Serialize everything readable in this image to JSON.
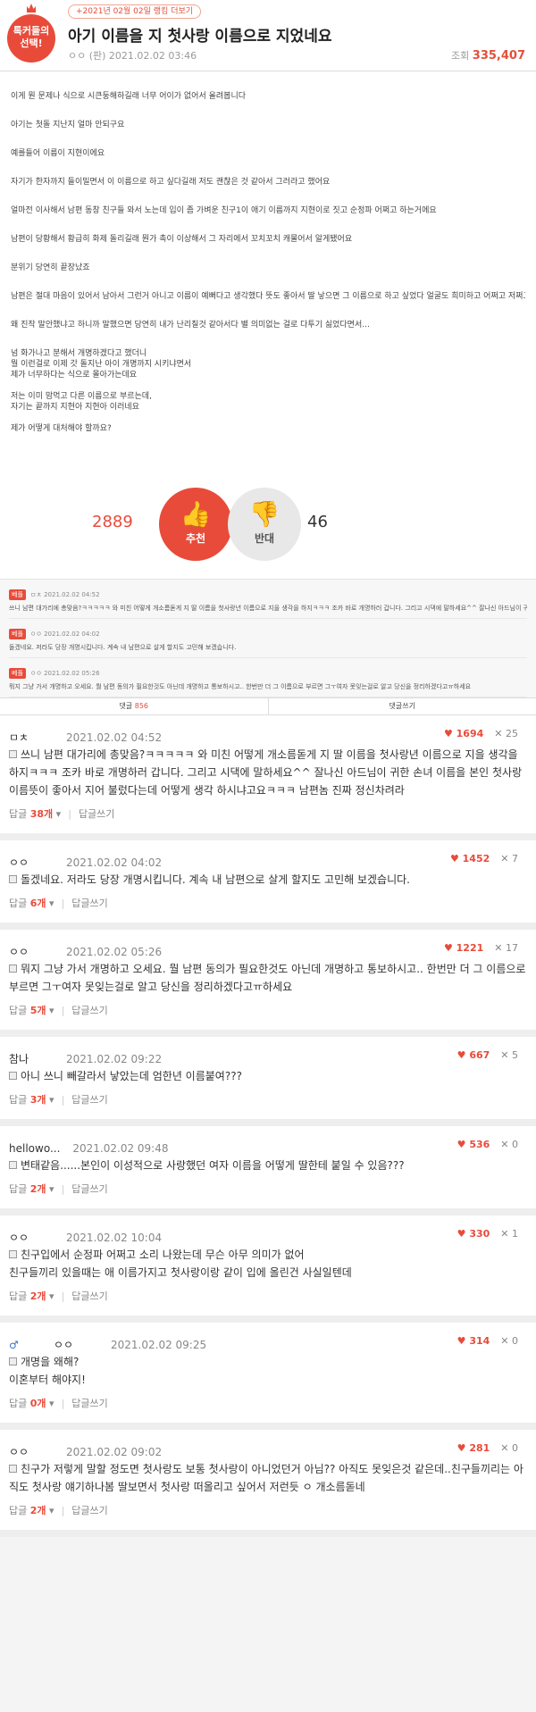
{
  "post": {
    "badge": "톡커들의\n선택!",
    "rank_pill": "+2021년 02월 02일 랭킹 더보기",
    "title": "아기 이름을 지 첫사랑 이름으로 지었네요",
    "author_date": "ㅇㅇ (판)  2021.02.02 03:46",
    "views_label": "조회",
    "views": "335,407",
    "paragraphs": [
      "이게 뭔 문제나 식으로 시큰둥해하길래 너무 어이가 없어서 올려봅니다",
      "아기는 첫돌 지난지 얼마 안되구요",
      "예를들어 이름이 지현이에요",
      "자기가 한자까지 들이밀면서 이 이름으로 하고 싶다길래 저도 괜찮은 것 같아서 그러라고 했어요",
      "얼마전 이사해서 남편 동창 친구들 와서 노는데 입이 좀 가벼운 친구1이 애기 이름까지 지현이로 짓고 순정파 어쩌고 하는거에요",
      "남편이 당황해서 황급히 화제 돌리길래 뭔가 촉이 이상해서 그 자리에서 꼬치꼬치 캐물어서 알게됐어요",
      "분위기 당연히 끝장났죠",
      "남편은 절대 마음이 있어서 남아서 그런거 아니고 이름이 예뻐다고 생각했다 뜻도 좋아서 딸 낳으면 그 이름으로 하고 싶었다 얼굴도 희미하고 어쩌고 저쩌고",
      "왜 진작 말안했냐고 하니까 말했으면 당연히 내가 난리칠것 같아서다 별 의미없는 걸로 다투기 싫었다면서...",
      "넘 화가나고 분해서 개명하겠다고 했더니\n뭘 이런걸로 이제 갓 돌지난 아이 개명까지 시키냐면서\n제가 너무하다는 식으로 몰아가는데요",
      "저는 이미 맘먹고 다른 이름으로 부르는데,\n자기는 끝까지 지현아 지현아 이러네요",
      "제가 어떻게 대처해야 할까요?"
    ],
    "up_count": "2889",
    "up_label": "추천",
    "down_label": "반대",
    "down_count": "46"
  },
  "best": [
    {
      "tag": "베플",
      "meta": "ㅁㅊ  2021.02.02 04:52",
      "text": "쓰니 남편 대가리에 총맞음?ㅋㅋㅋㅋㅋ 와 미친 어떻게 개소름돋게 지 딸 이름을 첫사랑년 이름으로 지을 생각을 하지ㅋㅋㅋ 조카 바로 개명하러 갑니다. 그리고 시댁에 말하세요^^ 잘나신 아드님이 귀한 손녀 이름을 본인 첫사랑 이름뜻이 좋아서 지어 불렀다는데 어떻게 생각 하시냐고요ㅋㅋㅋ 남편놈 진짜 정신차려라"
    },
    {
      "tag": "베플",
      "meta": "ㅇㅇ  2021.02.02 04:02",
      "text": "돌겠네요. 저라도 당장 개명시킵니다. 계속 내 남편으로 살게 할지도 고민해 보겠습니다."
    },
    {
      "tag": "베플",
      "meta": "ㅇㅇ  2021.02.02 05:26",
      "text": "뭐지 그냥 가서 개명하고 오세요. 뭘 남편 동의가 필요한것도 아닌데 개명하고 통보하시고.. 한번만 더 그 이름으로 부르면 그ㅜ여자 못잊는걸로 알고 당신을 정리하겠다고ㅠ하세요"
    }
  ],
  "tabs": {
    "comments_label": "댓글",
    "comments_count": "856",
    "write_label": "댓글쓰기"
  },
  "comments": [
    {
      "author": "ㅁㅊ",
      "date": "2021.02.02 04:52",
      "likes": "1694",
      "dislikes": "25",
      "text": "쓰니 남편 대가리에 총맞음?ㅋㅋㅋㅋㅋ 와 미친 어떻게 개소름돋게 지 딸 이름을 첫사랑년 이름으로 지을 생각을 하지ㅋㅋㅋ 조카 바로 개명하러 갑니다. 그리고 시댁에 말하세요^^ 잘나신 아드님이 귀한 손녀 이름을 본인 첫사랑 이름뜻이 좋아서 지어 불렀다는데 어떻게 생각 하시냐고요ㅋㅋㅋ 남편놈 진짜 정신차려라",
      "reply_label": "답글",
      "reply_count": "38개",
      "write": "답글쓰기"
    },
    {
      "author": "ㅇㅇ",
      "date": "2021.02.02 04:02",
      "likes": "1452",
      "dislikes": "7",
      "text": "돌겠네요. 저라도 당장 개명시킵니다. 계속 내 남편으로 살게 할지도 고민해 보겠습니다.",
      "reply_label": "답글",
      "reply_count": "6개",
      "write": "답글쓰기"
    },
    {
      "author": "ㅇㅇ",
      "date": "2021.02.02 05:26",
      "likes": "1221",
      "dislikes": "17",
      "text": "뭐지 그냥 가서 개명하고 오세요. 뭘 남편 동의가 필요한것도 아닌데 개명하고 통보하시고.. 한번만 더 그 이름으로 부르면 그ㅜ여자 못잊는걸로 알고 당신을 정리하겠다고ㅠ하세요",
      "reply_label": "답글",
      "reply_count": "5개",
      "write": "답글쓰기"
    },
    {
      "author": "참나",
      "date": "2021.02.02 09:22",
      "likes": "667",
      "dislikes": "5",
      "text": "아니 쓰니 빼갈라서 낳았는데 엄한년 이름붙여???",
      "reply_label": "답글",
      "reply_count": "3개",
      "write": "답글쓰기"
    },
    {
      "author": "hellowo...",
      "date": "2021.02.02 09:48",
      "likes": "536",
      "dislikes": "0",
      "text": "변태같음......본인이 이성적으로 사랑했던 여자 이름을 어떻게 딸한테 붙일 수 있음???",
      "reply_label": "답글",
      "reply_count": "2개",
      "write": "답글쓰기"
    },
    {
      "author": "ㅇㅇ",
      "date": "2021.02.02 10:04",
      "likes": "330",
      "dislikes": "1",
      "text": "친구입에서 순정파 어쩌고 소리 나왔는데 무슨 아무 의미가 없어\n친구들끼리 있을때는 애 이름가지고 첫사랑이랑 같이 입에 올린건 사실일텐데",
      "reply_label": "답글",
      "reply_count": "2개",
      "write": "답글쓰기"
    },
    {
      "author": "ㅇㅇ",
      "male": true,
      "date": "2021.02.02 09:25",
      "likes": "314",
      "dislikes": "0",
      "text": "개명을 왜해?\n이혼부터 해야지!",
      "reply_label": "답글",
      "reply_count": "0개",
      "write": "답글쓰기"
    },
    {
      "author": "ㅇㅇ",
      "date": "2021.02.02 09:02",
      "likes": "281",
      "dislikes": "0",
      "text": "친구가 저렇게 말할 정도면 첫사랑도 보통 첫사랑이 아니었던거 아님?? 아직도 못잊은것 같은데..친구들끼리는 아직도 첫사랑 얘기하나봄 딸보면서 첫사랑 떠올리고 싶어서 저런듯 ㅇ 개소름돋네",
      "reply_label": "답글",
      "reply_count": "2개",
      "write": "답글쓰기"
    }
  ],
  "icons": {
    "thumb_up": "thumb-up-icon",
    "thumb_down": "thumb-down-icon",
    "crown": "crown-icon",
    "male": "male-icon"
  },
  "colors": {
    "accent": "#e84b3a",
    "male": "#3874c8"
  }
}
